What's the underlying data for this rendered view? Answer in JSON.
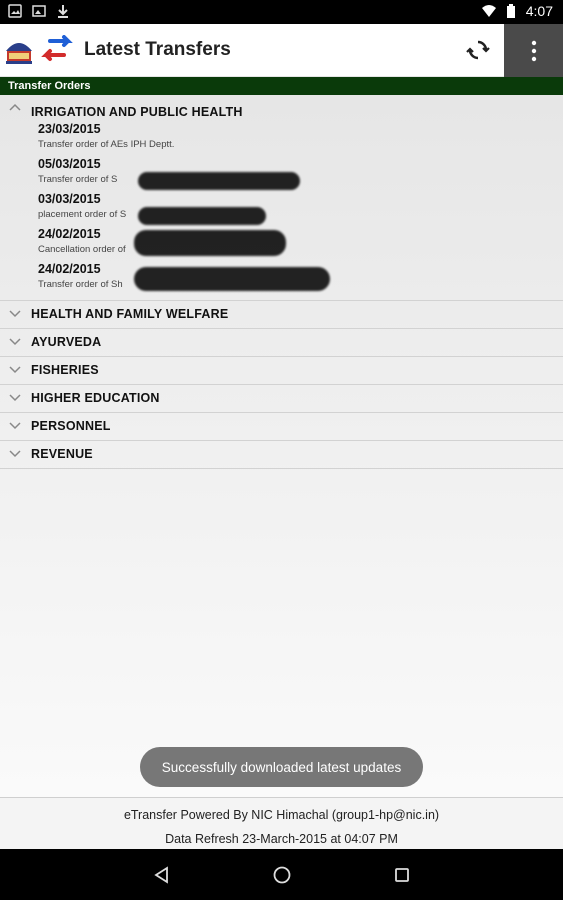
{
  "status_bar": {
    "time": "4:07",
    "icons_left": [
      "photo-icon",
      "image-icon",
      "download-icon"
    ],
    "icons_right": [
      "wifi-icon",
      "battery-icon"
    ]
  },
  "app_bar": {
    "title": "Latest Transfers",
    "logo_icon": "himachal-emblem-icon",
    "transfer_icon": "transfer-arrows-icon",
    "refresh_icon": "refresh-icon",
    "menu_icon": "overflow-menu-icon"
  },
  "section": {
    "title": "Transfer Orders"
  },
  "groups": [
    {
      "title": "IRRIGATION AND PUBLIC HEALTH",
      "expanded": true,
      "items": [
        {
          "date": "23/03/2015",
          "desc": "Transfer order of AEs IPH Deptt."
        },
        {
          "date": "05/03/2015",
          "desc": "Transfer order of S"
        },
        {
          "date": "03/03/2015",
          "desc": "placement order of S"
        },
        {
          "date": "24/02/2015",
          "desc": "Cancellation order of"
        },
        {
          "date": "24/02/2015",
          "desc": "Transfer order of Sh"
        }
      ]
    },
    {
      "title": "HEALTH AND FAMILY WELFARE",
      "expanded": false
    },
    {
      "title": "AYURVEDA",
      "expanded": false
    },
    {
      "title": "FISHERIES",
      "expanded": false
    },
    {
      "title": "HIGHER EDUCATION",
      "expanded": false
    },
    {
      "title": "PERSONNEL",
      "expanded": false
    },
    {
      "title": "REVENUE",
      "expanded": false
    }
  ],
  "toast": {
    "text": "Successfully downloaded latest updates"
  },
  "footer": {
    "line1": "eTransfer Powered By NIC Himachal (group1-hp@nic.in)",
    "line2": "Data Refresh 23-March-2015 at 04:07 PM"
  },
  "nav_bar": {
    "icons": [
      "back-icon",
      "home-icon",
      "recents-icon"
    ]
  },
  "colors": {
    "section_header_bg": "#0a3a0a",
    "overflow_bg": "#4a4a4a",
    "toast_bg": "#777777"
  }
}
